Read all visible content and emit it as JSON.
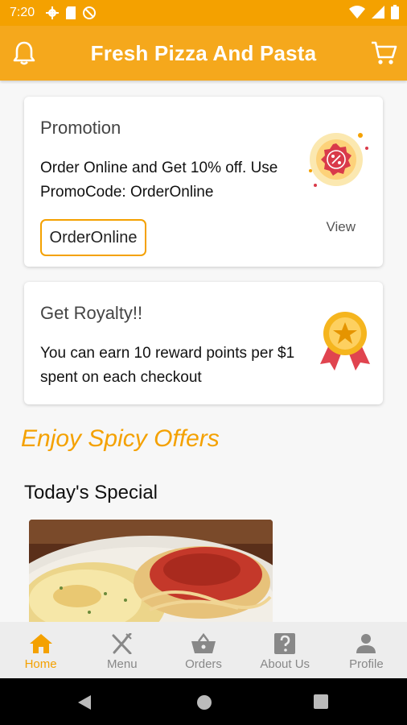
{
  "status": {
    "time": "7:20"
  },
  "appbar": {
    "title": "Fresh Pizza And Pasta"
  },
  "promotion": {
    "title": "Promotion",
    "line1": "Order Online and Get 10% off. Use",
    "line2": "PromoCode: OrderOnline",
    "code_button": "OrderOnline",
    "view_link": "View"
  },
  "royalty": {
    "title": "Get Royalty!!",
    "line1": "You can earn 10 reward points per $1",
    "line2": "spent on each checkout"
  },
  "offers": {
    "heading": "Enjoy Spicy Offers"
  },
  "special": {
    "heading": "Today's Special"
  },
  "nav": {
    "items": [
      {
        "label": "Home",
        "icon": "home-icon",
        "active": true
      },
      {
        "label": "Menu",
        "icon": "menu-utensils-icon"
      },
      {
        "label": "Orders",
        "icon": "basket-icon"
      },
      {
        "label": "About Us",
        "icon": "question-icon"
      },
      {
        "label": "Profile",
        "icon": "person-icon"
      }
    ]
  },
  "colors": {
    "accent": "#f4a100",
    "appbar": "#f5a81c"
  }
}
